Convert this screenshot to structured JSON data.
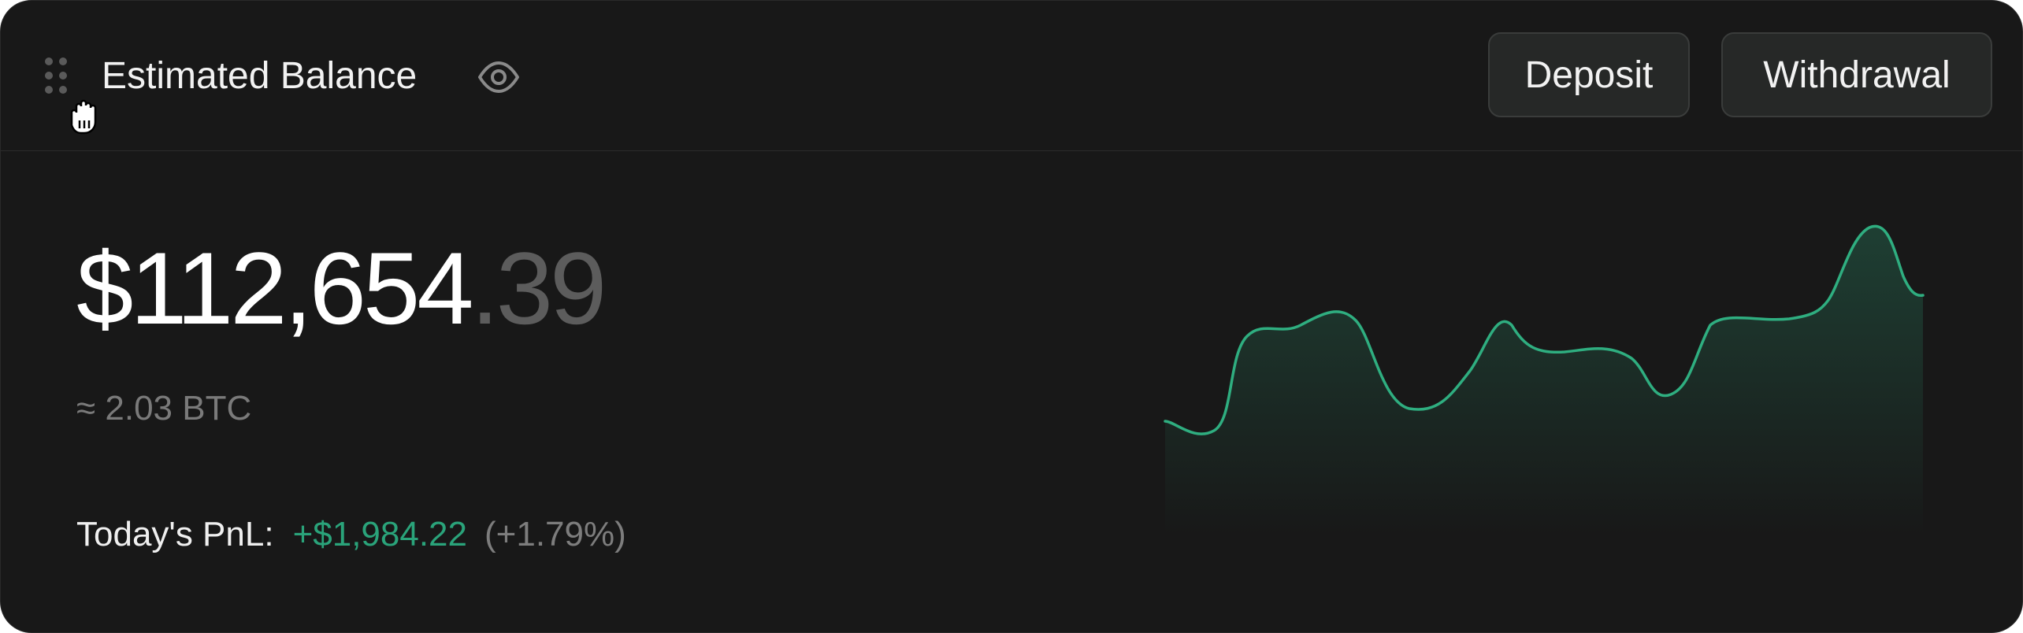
{
  "header": {
    "title": "Estimated Balance",
    "buttons": {
      "deposit_label": "Deposit",
      "withdrawal_label": "Withdrawal"
    },
    "icons": [
      "drag-handle-icon",
      "hand-cursor-icon",
      "eye-icon"
    ]
  },
  "balance": {
    "integer_part": "$112,654",
    "decimal_part": ".39",
    "btc_equivalent": "≈ 2.03 BTC"
  },
  "pnl": {
    "label": "Today's PnL:",
    "value": "+$1,984.22",
    "percent": "(+1.79%)"
  },
  "colors": {
    "card_background": "#181818",
    "positive": "#2aa37a",
    "muted": "#7a7a7a",
    "spark_line": "#2fae80"
  }
}
